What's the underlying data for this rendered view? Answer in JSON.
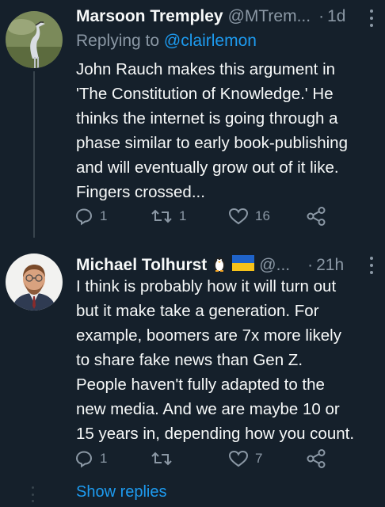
{
  "tweets": [
    {
      "name": "Marsoon Trempley",
      "handle": "@MTrem...",
      "time": "1d",
      "reply_prefix": "Replying to ",
      "reply_mention": "@clairlemon",
      "body": "John Rauch makes this argument in\n'The Constitution of Knowledge.' He\nthinks the internet is going through a\nphase similar to early book-publishing\nand will eventually grow out of it like.\nFingers crossed...",
      "replies": "1",
      "retweets": "1",
      "likes": "16"
    },
    {
      "name": "Michael Tolhurst",
      "handle": "@...",
      "time": "21h",
      "body": "I think is probably how it will turn out\nbut it make take a generation. For\nexample, boomers are 7x more likely\nto share fake news than Gen Z.\nPeople haven't fully adapted to the\nnew media. And we are maybe 10 or\n15 years in, depending how you count.",
      "replies": "1",
      "retweets": "",
      "likes": "7"
    }
  ],
  "show_replies": "Show replies",
  "colors": {
    "background": "#15202b",
    "text": "#f7f9f9",
    "muted": "#8b98a5",
    "accent": "#1d9bf0"
  },
  "icons": [
    "reply-icon",
    "retweet-icon",
    "like-icon",
    "share-icon",
    "more-icon",
    "penguin-icon",
    "ukraine-flag-icon"
  ]
}
